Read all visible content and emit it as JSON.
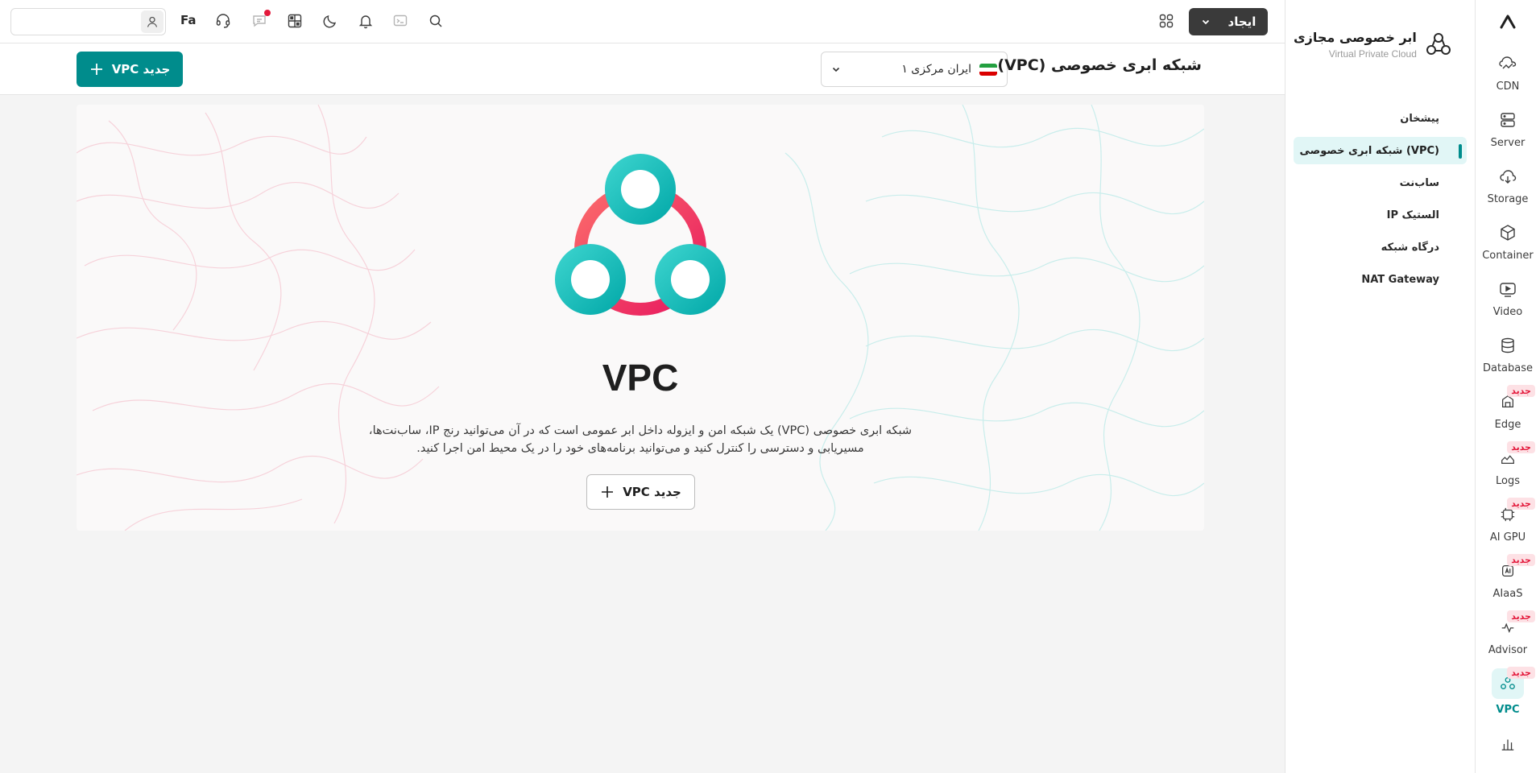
{
  "rail": {
    "items": [
      {
        "label": "CDN",
        "icon": "cdn-icon"
      },
      {
        "label": "Server",
        "icon": "server-icon"
      },
      {
        "label": "Storage",
        "icon": "cloud-storage-icon"
      },
      {
        "label": "Container",
        "icon": "container-cube-icon"
      },
      {
        "label": "Video",
        "icon": "video-play-icon"
      },
      {
        "label": "Database",
        "icon": "database-icon"
      },
      {
        "label": "Edge",
        "icon": "edge-icon",
        "badge": "جدید"
      },
      {
        "label": "Logs",
        "icon": "logs-icon",
        "badge": "جدید"
      },
      {
        "label": "AI GPU",
        "icon": "ai-gpu-icon",
        "badge": "جدید"
      },
      {
        "label": "AIaaS",
        "icon": "aiaas-icon",
        "badge": "جدید"
      },
      {
        "label": "Advisor",
        "icon": "advisor-icon",
        "badge": "جدید"
      },
      {
        "label": "VPC",
        "icon": "vpc-icon",
        "badge": "جدید",
        "active": true
      }
    ]
  },
  "sidebar": {
    "title": "ابر خصوصی مجازی",
    "subtitle": "Virtual Private Cloud",
    "items": [
      {
        "label": "پیشخان"
      },
      {
        "label": "شبکه ابری خصوصی (VPC)",
        "active": true
      },
      {
        "label": "ساب‌نت"
      },
      {
        "label": "IP الستیک"
      },
      {
        "label": "درگاه شبکه"
      },
      {
        "label": "NAT Gateway"
      }
    ]
  },
  "topbar": {
    "create_label": "ایجاد",
    "lang_label": "Fa",
    "user_value": ""
  },
  "page": {
    "title": "شبکه ابری خصوصی (VPC)",
    "region": "ایران مرکزی ۱",
    "new_vpc_label": "VPC جدید"
  },
  "hero": {
    "title": "VPC",
    "description_line1": "شبکه ابری خصوصی (VPC) یک شبکه امن و ایزوله داخل ابر عمومی است که در آن می‌توانید رنج IP، ساب‌نت‌ها،",
    "description_line2": "مسیریابی و دسترسی را کنترل کنید و می‌توانید برنامه‌های خود را در یک محیط امن اجرا کنید.",
    "button_label": "VPC جدید"
  },
  "colors": {
    "accent": "#008c8c",
    "accent_light": "#e1f6f6",
    "badge_bg": "#fde1e5",
    "badge_text": "#e3193b",
    "logo_ring": "#f0325a",
    "logo_circle": "#13c2c2"
  }
}
